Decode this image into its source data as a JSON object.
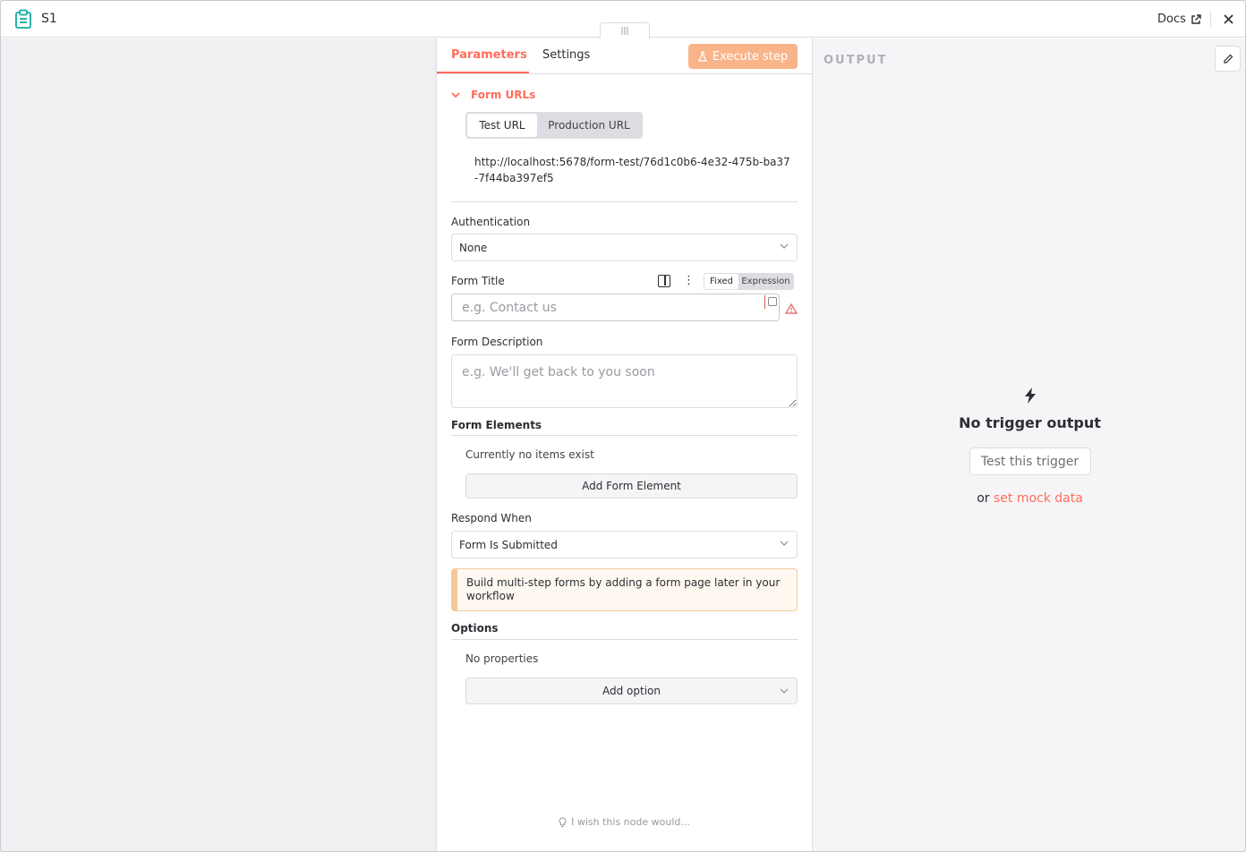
{
  "header": {
    "node_name": "S1",
    "docs_label": "Docs"
  },
  "tabs": {
    "parameters": "Parameters",
    "settings": "Settings"
  },
  "execute_button": "Execute step",
  "form_urls": {
    "section_label": "Form URLs",
    "test_url_tab": "Test URL",
    "production_url_tab": "Production URL",
    "url": "http://localhost:5678/form-test/76d1c0b6-4e32-475b-ba37-7f44ba397ef5"
  },
  "authentication": {
    "label": "Authentication",
    "value": "None"
  },
  "form_title": {
    "label": "Form Title",
    "mode_fixed": "Fixed",
    "mode_expression": "Expression",
    "placeholder": "e.g. Contact us"
  },
  "form_description": {
    "label": "Form Description",
    "placeholder": "e.g. We'll get back to you soon"
  },
  "form_elements": {
    "label": "Form Elements",
    "empty_text": "Currently no items exist",
    "add_button": "Add Form Element"
  },
  "respond_when": {
    "label": "Respond When",
    "value": "Form Is Submitted"
  },
  "callout": {
    "text": "Build multi-step forms by adding a form page later in your workflow"
  },
  "options": {
    "label": "Options",
    "empty_text": "No properties",
    "add_button": "Add option"
  },
  "feedback": {
    "text": "I wish this node would..."
  },
  "output": {
    "title": "OUTPUT",
    "empty_title": "No trigger output",
    "test_button": "Test this trigger",
    "or_text": "or",
    "mock_link": "set mock data"
  },
  "colors": {
    "accent": "#ff6d5a",
    "node_icon": "#2bb3a8",
    "warning": "#e05a5a"
  }
}
